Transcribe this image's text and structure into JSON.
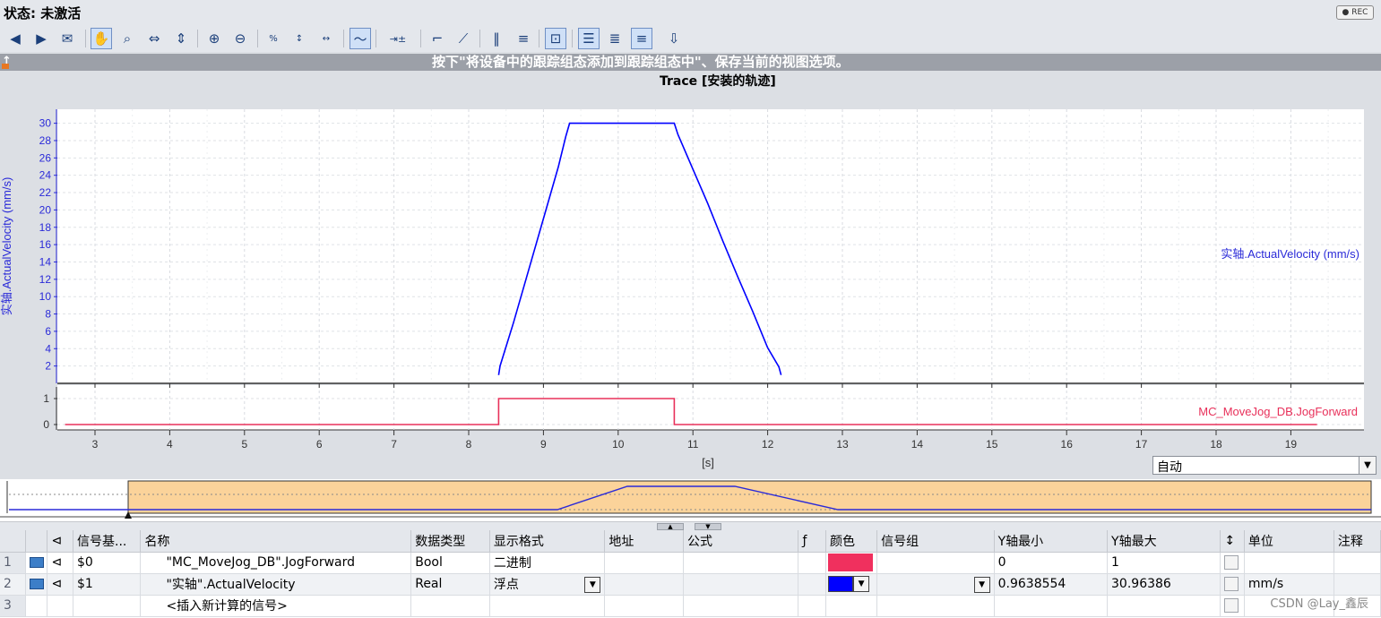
{
  "window": {
    "title": "状态: 未激活",
    "rec_label": "● REC"
  },
  "toolbar": {
    "icons": [
      "back-icon",
      "forward-icon",
      "mail-icon",
      "hand-icon",
      "zoom-area-icon",
      "zoom-h-icon",
      "zoom-v-icon",
      "zoom-in-icon",
      "zoom-out-icon",
      "zoom-100-icon",
      "y-zoom-100-icon",
      "x-zoom-100-icon",
      "chart-view-icon",
      "measure-icon",
      "line-icon",
      "step-icon",
      "columns-icon",
      "rows-icon",
      "cursor-icon",
      "list-icon",
      "align-left-icon",
      "align-right-icon",
      "export-icon"
    ]
  },
  "hint": {
    "text": "按下\"将设备中的跟踪组态添加到跟踪组态中\"、保存当前的视图选项。"
  },
  "chart": {
    "title": "Trace [安装的轨迹]",
    "xunit": "[s]",
    "right_label_top": "实轴.ActualVelocity (mm/s)",
    "right_label_bottom": "MC_MoveJog_DB.JogForward",
    "ylabel": "实轴.ActualVelocity (mm/s)",
    "colors": {
      "velocity": "#0000ff",
      "jog": "#e8305a"
    }
  },
  "chart_data": {
    "type": "line",
    "title": "Trace [安装的轨迹]",
    "xlabel": "[s]",
    "xlim": [
      2.5,
      20.0
    ],
    "x_ticks": [
      3,
      4,
      5,
      6,
      7,
      8,
      9,
      10,
      11,
      12,
      13,
      14,
      15,
      16,
      17,
      18,
      19
    ],
    "series": [
      {
        "name": "实轴.ActualVelocity (mm/s)",
        "ylim": [
          0,
          31
        ],
        "y_ticks": [
          2,
          4,
          6,
          8,
          10,
          12,
          14,
          16,
          18,
          20,
          22,
          24,
          26,
          28,
          30
        ],
        "x": [
          8.4,
          8.42,
          8.6,
          8.8,
          9.0,
          9.2,
          9.3,
          9.35,
          10.75,
          10.8,
          11.0,
          11.2,
          11.4,
          11.6,
          11.8,
          12.0,
          12.15,
          12.18
        ],
        "y": [
          0.96,
          2,
          7,
          13,
          19,
          25,
          28.5,
          30,
          30,
          28.7,
          24.7,
          20.7,
          16.4,
          12.3,
          8.3,
          4.1,
          1.9,
          0.96
        ]
      },
      {
        "name": "MC_MoveJog_DB.JogForward",
        "ylim": [
          -0.2,
          1.3
        ],
        "y_ticks": [
          0,
          1
        ],
        "x": [
          2.6,
          8.4,
          8.4,
          10.75,
          10.75,
          19.35
        ],
        "y": [
          0,
          0,
          1,
          1,
          0,
          0
        ]
      }
    ]
  },
  "timebase": {
    "value": "自动"
  },
  "table": {
    "headers": [
      "信号基...",
      "名称",
      "数据类型",
      "显示格式",
      "地址",
      "公式",
      "颜色",
      "信号组",
      "Y轴最小",
      "Y轴最大",
      "单位",
      "注释"
    ],
    "rows": [
      {
        "num": "1",
        "signal": "$0",
        "name": "\"MC_MoveJog_DB\".JogForward",
        "dtype": "Bool",
        "fmt": "二进制",
        "ymin": "0",
        "ymax": "1",
        "unit": "",
        "color": "#f0305e"
      },
      {
        "num": "2",
        "signal": "$1",
        "name": "\"实轴\".ActualVelocity",
        "dtype": "Real",
        "fmt": "浮点",
        "ymin": "0.9638554",
        "ymax": "30.96386",
        "unit": "mm/s",
        "color": "#0000ff"
      },
      {
        "num": "3",
        "signal": "",
        "name": "<插入新计算的信号>",
        "dtype": "",
        "fmt": "",
        "ymin": "",
        "ymax": "",
        "unit": "",
        "color": ""
      }
    ]
  },
  "watermark": "CSDN @Lay_鑫辰"
}
